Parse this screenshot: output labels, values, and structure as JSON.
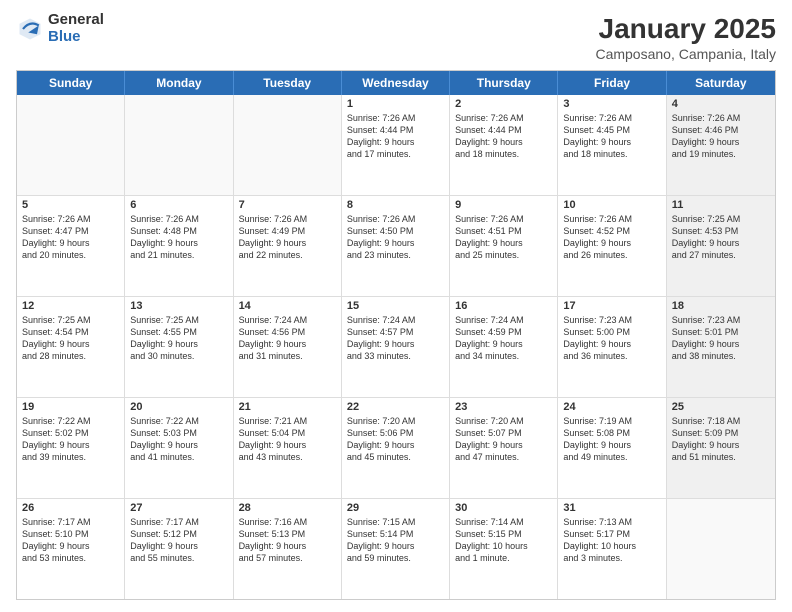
{
  "header": {
    "logo_general": "General",
    "logo_blue": "Blue",
    "month_title": "January 2025",
    "location": "Camposano, Campania, Italy"
  },
  "weekdays": [
    "Sunday",
    "Monday",
    "Tuesday",
    "Wednesday",
    "Thursday",
    "Friday",
    "Saturday"
  ],
  "rows": [
    [
      {
        "day": "",
        "text": "",
        "shaded": true,
        "empty": true
      },
      {
        "day": "",
        "text": "",
        "shaded": true,
        "empty": true
      },
      {
        "day": "",
        "text": "",
        "shaded": true,
        "empty": true
      },
      {
        "day": "1",
        "text": "Sunrise: 7:26 AM\nSunset: 4:44 PM\nDaylight: 9 hours\nand 17 minutes.",
        "shaded": false
      },
      {
        "day": "2",
        "text": "Sunrise: 7:26 AM\nSunset: 4:44 PM\nDaylight: 9 hours\nand 18 minutes.",
        "shaded": false
      },
      {
        "day": "3",
        "text": "Sunrise: 7:26 AM\nSunset: 4:45 PM\nDaylight: 9 hours\nand 18 minutes.",
        "shaded": false
      },
      {
        "day": "4",
        "text": "Sunrise: 7:26 AM\nSunset: 4:46 PM\nDaylight: 9 hours\nand 19 minutes.",
        "shaded": true
      }
    ],
    [
      {
        "day": "5",
        "text": "Sunrise: 7:26 AM\nSunset: 4:47 PM\nDaylight: 9 hours\nand 20 minutes.",
        "shaded": false
      },
      {
        "day": "6",
        "text": "Sunrise: 7:26 AM\nSunset: 4:48 PM\nDaylight: 9 hours\nand 21 minutes.",
        "shaded": false
      },
      {
        "day": "7",
        "text": "Sunrise: 7:26 AM\nSunset: 4:49 PM\nDaylight: 9 hours\nand 22 minutes.",
        "shaded": false
      },
      {
        "day": "8",
        "text": "Sunrise: 7:26 AM\nSunset: 4:50 PM\nDaylight: 9 hours\nand 23 minutes.",
        "shaded": false
      },
      {
        "day": "9",
        "text": "Sunrise: 7:26 AM\nSunset: 4:51 PM\nDaylight: 9 hours\nand 25 minutes.",
        "shaded": false
      },
      {
        "day": "10",
        "text": "Sunrise: 7:26 AM\nSunset: 4:52 PM\nDaylight: 9 hours\nand 26 minutes.",
        "shaded": false
      },
      {
        "day": "11",
        "text": "Sunrise: 7:25 AM\nSunset: 4:53 PM\nDaylight: 9 hours\nand 27 minutes.",
        "shaded": true
      }
    ],
    [
      {
        "day": "12",
        "text": "Sunrise: 7:25 AM\nSunset: 4:54 PM\nDaylight: 9 hours\nand 28 minutes.",
        "shaded": false
      },
      {
        "day": "13",
        "text": "Sunrise: 7:25 AM\nSunset: 4:55 PM\nDaylight: 9 hours\nand 30 minutes.",
        "shaded": false
      },
      {
        "day": "14",
        "text": "Sunrise: 7:24 AM\nSunset: 4:56 PM\nDaylight: 9 hours\nand 31 minutes.",
        "shaded": false
      },
      {
        "day": "15",
        "text": "Sunrise: 7:24 AM\nSunset: 4:57 PM\nDaylight: 9 hours\nand 33 minutes.",
        "shaded": false
      },
      {
        "day": "16",
        "text": "Sunrise: 7:24 AM\nSunset: 4:59 PM\nDaylight: 9 hours\nand 34 minutes.",
        "shaded": false
      },
      {
        "day": "17",
        "text": "Sunrise: 7:23 AM\nSunset: 5:00 PM\nDaylight: 9 hours\nand 36 minutes.",
        "shaded": false
      },
      {
        "day": "18",
        "text": "Sunrise: 7:23 AM\nSunset: 5:01 PM\nDaylight: 9 hours\nand 38 minutes.",
        "shaded": true
      }
    ],
    [
      {
        "day": "19",
        "text": "Sunrise: 7:22 AM\nSunset: 5:02 PM\nDaylight: 9 hours\nand 39 minutes.",
        "shaded": false
      },
      {
        "day": "20",
        "text": "Sunrise: 7:22 AM\nSunset: 5:03 PM\nDaylight: 9 hours\nand 41 minutes.",
        "shaded": false
      },
      {
        "day": "21",
        "text": "Sunrise: 7:21 AM\nSunset: 5:04 PM\nDaylight: 9 hours\nand 43 minutes.",
        "shaded": false
      },
      {
        "day": "22",
        "text": "Sunrise: 7:20 AM\nSunset: 5:06 PM\nDaylight: 9 hours\nand 45 minutes.",
        "shaded": false
      },
      {
        "day": "23",
        "text": "Sunrise: 7:20 AM\nSunset: 5:07 PM\nDaylight: 9 hours\nand 47 minutes.",
        "shaded": false
      },
      {
        "day": "24",
        "text": "Sunrise: 7:19 AM\nSunset: 5:08 PM\nDaylight: 9 hours\nand 49 minutes.",
        "shaded": false
      },
      {
        "day": "25",
        "text": "Sunrise: 7:18 AM\nSunset: 5:09 PM\nDaylight: 9 hours\nand 51 minutes.",
        "shaded": true
      }
    ],
    [
      {
        "day": "26",
        "text": "Sunrise: 7:17 AM\nSunset: 5:10 PM\nDaylight: 9 hours\nand 53 minutes.",
        "shaded": false
      },
      {
        "day": "27",
        "text": "Sunrise: 7:17 AM\nSunset: 5:12 PM\nDaylight: 9 hours\nand 55 minutes.",
        "shaded": false
      },
      {
        "day": "28",
        "text": "Sunrise: 7:16 AM\nSunset: 5:13 PM\nDaylight: 9 hours\nand 57 minutes.",
        "shaded": false
      },
      {
        "day": "29",
        "text": "Sunrise: 7:15 AM\nSunset: 5:14 PM\nDaylight: 9 hours\nand 59 minutes.",
        "shaded": false
      },
      {
        "day": "30",
        "text": "Sunrise: 7:14 AM\nSunset: 5:15 PM\nDaylight: 10 hours\nand 1 minute.",
        "shaded": false
      },
      {
        "day": "31",
        "text": "Sunrise: 7:13 AM\nSunset: 5:17 PM\nDaylight: 10 hours\nand 3 minutes.",
        "shaded": false
      },
      {
        "day": "",
        "text": "",
        "shaded": true,
        "empty": true
      }
    ]
  ]
}
